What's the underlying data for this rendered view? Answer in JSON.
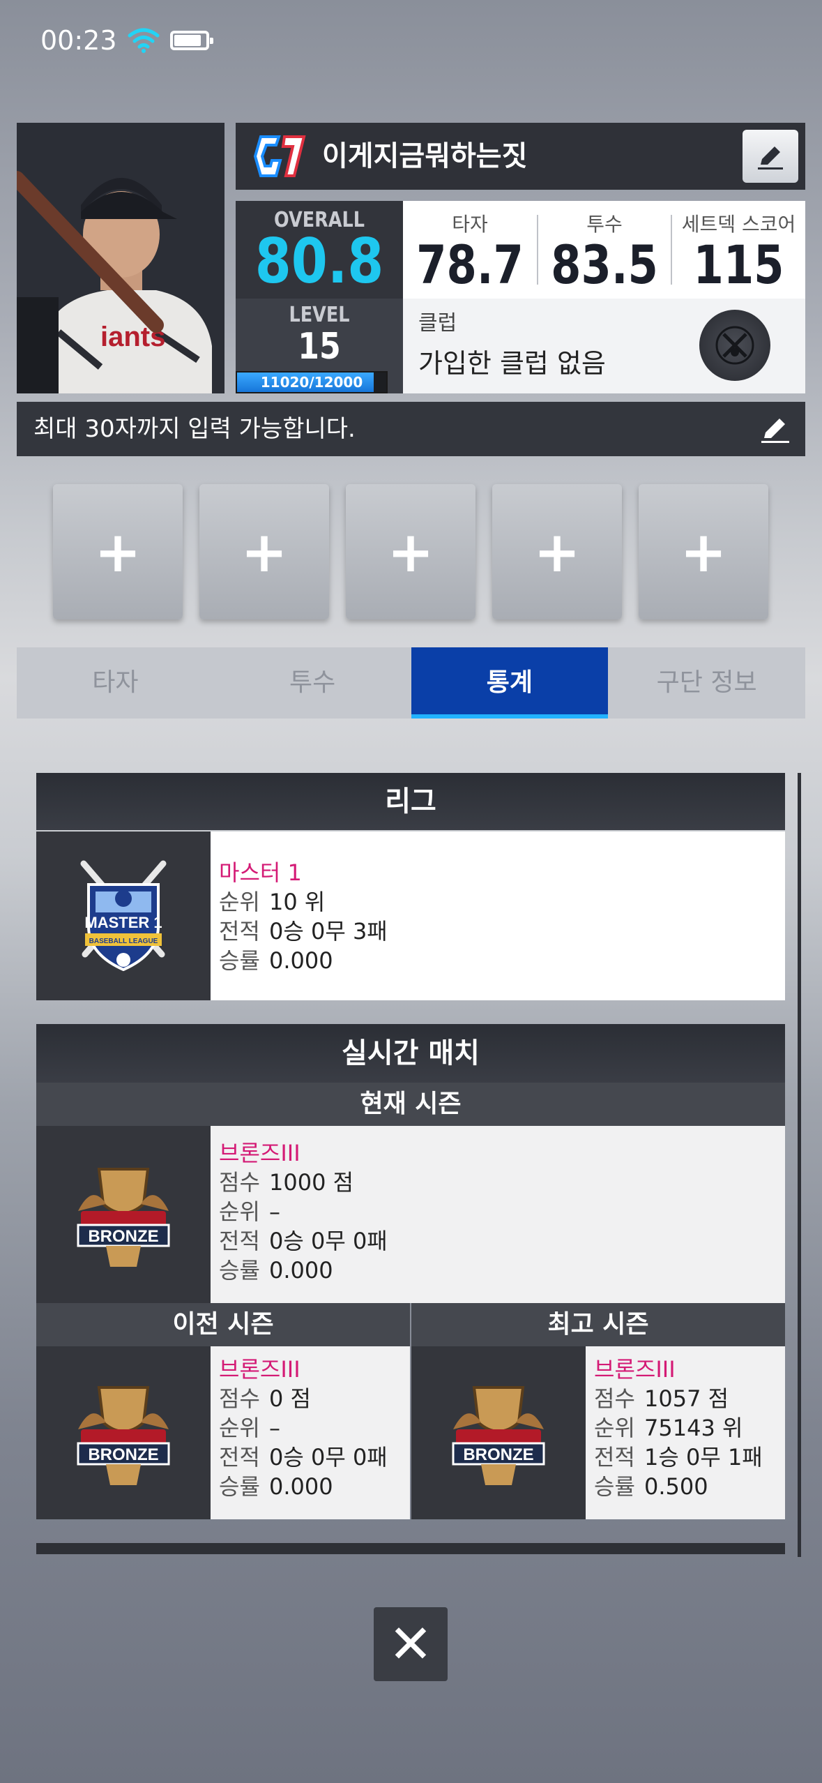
{
  "status_bar": {
    "time": "00:23"
  },
  "profile": {
    "player_name": "이게지금뭐하는짓",
    "overall_label": "OVERALL",
    "overall_value": "80.8",
    "level_label": "LEVEL",
    "level_value": "15",
    "xp_text": "11020/12000",
    "xp_fraction": 0.918,
    "stats": [
      {
        "label": "타자",
        "value": "78.7"
      },
      {
        "label": "투수",
        "value": "83.5"
      },
      {
        "label": "세트덱 스코어",
        "value": "115"
      }
    ],
    "club_label": "클럽",
    "club_value": "가입한 클럽 없음",
    "bio_placeholder": "최대 30자까지 입력 가능합니다."
  },
  "slots": [
    "+",
    "+",
    "+",
    "+",
    "+"
  ],
  "tabs": [
    {
      "label": "타자",
      "active": false
    },
    {
      "label": "투수",
      "active": false
    },
    {
      "label": "통계",
      "active": true
    },
    {
      "label": "구단 정보",
      "active": false
    }
  ],
  "league": {
    "title": "리그",
    "badge_text": "MASTER 1",
    "badge_sub": "BASEBALL LEAGUE",
    "tier": "마스터 1",
    "rows": [
      {
        "k": "순위",
        "v": "10 위"
      },
      {
        "k": "전적",
        "v": "0승 0무 3패"
      },
      {
        "k": "승률",
        "v": "0.000"
      }
    ]
  },
  "realtime": {
    "title": "실시간 매치",
    "current": {
      "label": "현재 시즌",
      "badge_text": "BRONZE",
      "tier": "브론즈III",
      "rows": [
        {
          "k": "점수",
          "v": "1000 점"
        },
        {
          "k": "순위",
          "v": "–"
        },
        {
          "k": "전적",
          "v": "0승 0무 0패"
        },
        {
          "k": "승률",
          "v": "0.000"
        }
      ]
    },
    "previous": {
      "label": "이전 시즌",
      "badge_text": "BRONZE",
      "tier": "브론즈III",
      "rows": [
        {
          "k": "점수",
          "v": "0 점"
        },
        {
          "k": "순위",
          "v": "–"
        },
        {
          "k": "전적",
          "v": "0승 0무 0패"
        },
        {
          "k": "승률",
          "v": "0.000"
        }
      ]
    },
    "best": {
      "label": "최고 시즌",
      "badge_text": "BRONZE",
      "tier": "브론즈III",
      "rows": [
        {
          "k": "점수",
          "v": "1057 점"
        },
        {
          "k": "순위",
          "v": "75143 위"
        },
        {
          "k": "전적",
          "v": "1승 0무 1패"
        },
        {
          "k": "승률",
          "v": "0.500"
        }
      ]
    }
  },
  "close_label": "✕",
  "colors": {
    "accent_cyan": "#1ec7ef",
    "tab_active": "#0a3fa8",
    "tier_pink": "#d41a75"
  }
}
